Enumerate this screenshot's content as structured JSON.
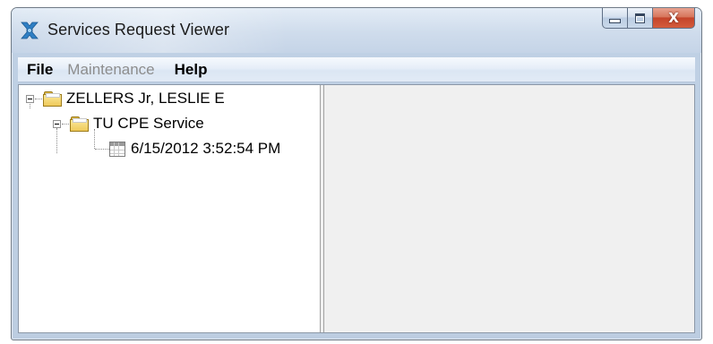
{
  "window": {
    "title": "Services Request Viewer",
    "icon": "services-app-icon",
    "close_glyph": "X"
  },
  "menu": {
    "file": "File",
    "maintenance": "Maintenance",
    "help": "Help"
  },
  "tree": {
    "root": {
      "label": "ZELLERS Jr, LESLIE E",
      "icon": "folder-icon",
      "expanded": true
    },
    "service": {
      "label": "TU CPE Service",
      "icon": "folder-icon",
      "expanded": true
    },
    "request": {
      "label": "6/15/2012 3:52:54 PM",
      "icon": "calendar-icon"
    }
  },
  "colors": {
    "close_button": "#c4442a",
    "disabled_menu": "#8d8d8d",
    "detail_pane": "#f0f0f0",
    "folder": "#efc95a"
  }
}
